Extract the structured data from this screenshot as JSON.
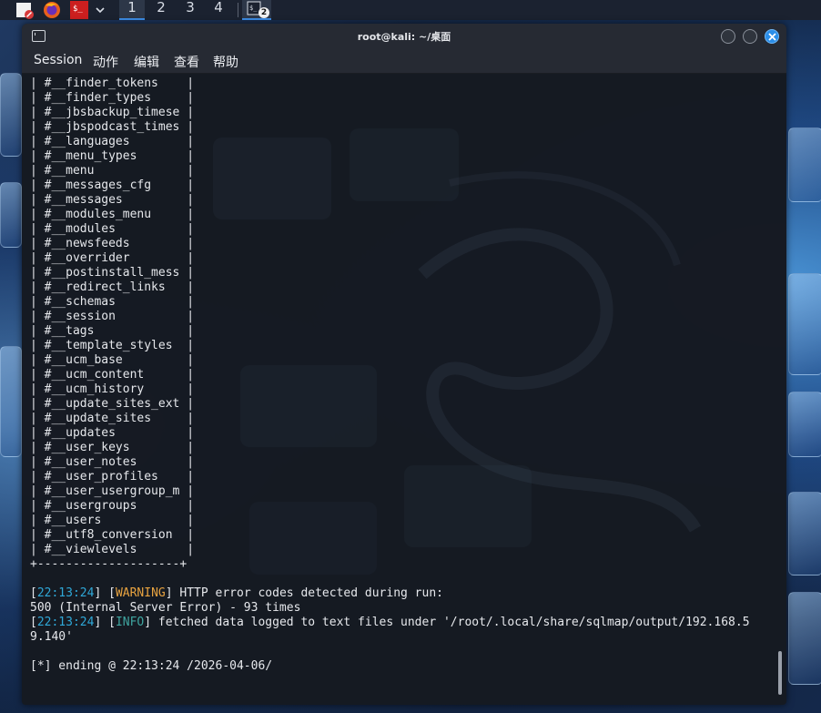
{
  "taskbar": {
    "workspaces": [
      "1",
      "2",
      "3",
      "4"
    ],
    "terminal_badge": "2"
  },
  "window": {
    "title": "root@kali: ~/桌面",
    "menu": [
      "Session",
      "动作",
      "编辑",
      "查看",
      "帮助"
    ]
  },
  "colors": {
    "timestamp": "#2fa8d8",
    "warning": "#e8a340",
    "info": "#3fa5a0",
    "close_button": "#2b8ee8",
    "active_workspace_underline": "#3d8ee8"
  },
  "terminal": {
    "table_rows": [
      "#__finder_tokens   ",
      "#__finder_types    ",
      "#__jbsbackup_timese",
      "#__jbspodcast_times",
      "#__languages       ",
      "#__menu_types      ",
      "#__menu            ",
      "#__messages_cfg    ",
      "#__messages        ",
      "#__modules_menu    ",
      "#__modules         ",
      "#__newsfeeds       ",
      "#__overrider       ",
      "#__postinstall_mess",
      "#__redirect_links  ",
      "#__schemas         ",
      "#__session         ",
      "#__tags            ",
      "#__template_styles ",
      "#__ucm_base        ",
      "#__ucm_content     ",
      "#__ucm_history     ",
      "#__update_sites_ext",
      "#__update_sites    ",
      "#__updates         ",
      "#__user_keys       ",
      "#__user_notes      ",
      "#__user_profiles   ",
      "#__user_usergroup_m",
      "#__usergroups      ",
      "#__users           ",
      "#__utf8_conversion ",
      "#__viewlevels      "
    ],
    "table_border": "+--------------------+",
    "log": {
      "warning_time": "22:13:24",
      "warning_tag": "WARNING",
      "warning_msg": " HTTP error codes detected during run:",
      "warning_detail": "500 (Internal Server Error) - 93 times",
      "info_time": "22:13:24",
      "info_tag": "INFO",
      "info_msg": " fetched data logged to text files under '/root/.local/share/sqlmap/output/192.168.5",
      "info_msg_cont": "9.140'",
      "ending": "[*] ending @ 22:13:24 /2026-04-06/"
    }
  }
}
